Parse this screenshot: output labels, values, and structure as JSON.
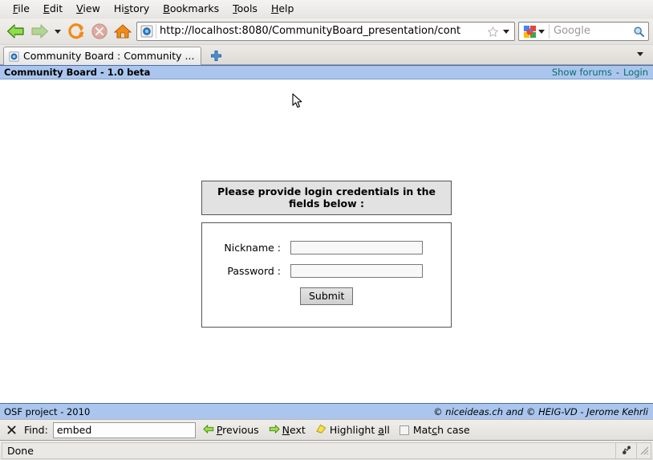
{
  "browser": {
    "menus": [
      {
        "label": "File",
        "accel": "F"
      },
      {
        "label": "Edit",
        "accel": "E"
      },
      {
        "label": "View",
        "accel": "V"
      },
      {
        "label": "History",
        "accel": "s"
      },
      {
        "label": "Bookmarks",
        "accel": "B"
      },
      {
        "label": "Tools",
        "accel": "T"
      },
      {
        "label": "Help",
        "accel": "H"
      }
    ],
    "toolbar": {
      "back_icon": "back-arrow-icon",
      "forward_icon": "forward-arrow-icon",
      "history_dropdown_icon": "chevron-down-icon",
      "reload_icon": "reload-icon",
      "stop_icon": "stop-icon",
      "home_icon": "home-icon"
    },
    "url": {
      "value": "http://localhost:8080/CommunityBoard_presentation/cont",
      "favicon": "page-globe-icon",
      "bookmark_icon": "star-icon",
      "dropdown_icon": "chevron-down-icon"
    },
    "search": {
      "engine": "google-logo-icon",
      "placeholder": "Google",
      "go_icon": "magnifier-icon",
      "dropdown_icon": "chevron-down-icon"
    },
    "tabs": [
      {
        "title": "Community Board : Community ...",
        "favicon": "page-globe-icon",
        "active": true
      }
    ],
    "newtab_label": "+",
    "tablist_icon": "chevron-down-icon"
  },
  "site": {
    "header": {
      "title": "Community Board - 1.0 beta",
      "links": [
        {
          "label": "Show forums"
        },
        {
          "label": "Login"
        }
      ],
      "separator": "-",
      "link_color": "#0e6b6b",
      "bar_color": "#aac6ee"
    },
    "login": {
      "banner": "Please provide login credentials in the fields below :",
      "fields": [
        {
          "label": "Nickname :",
          "value": "",
          "type": "text",
          "name": "nickname-field"
        },
        {
          "label": "Password :",
          "value": "",
          "type": "password",
          "name": "password-field"
        }
      ],
      "submit_label": "Submit"
    },
    "footer": {
      "left": "OSF project - 2010",
      "right": "© niceideas.ch and © HEIG-VD - Jerome Kehrli"
    }
  },
  "findbar": {
    "close_icon": "close-x-icon",
    "label": "Find:",
    "value": "embed",
    "placeholder": "",
    "previous_label": "Previous",
    "next_label": "Next",
    "highlight_label": "Highlight all",
    "matchcase_label": "Match case",
    "matchcase_checked": false,
    "previous_icon": "arrow-left-icon",
    "next_icon": "arrow-right-icon",
    "highlight_icon": "highlighter-icon"
  },
  "statusbar": {
    "text": "Done",
    "addon_icon": "addon-icon",
    "resize_icon": "resize-grip-icon"
  }
}
